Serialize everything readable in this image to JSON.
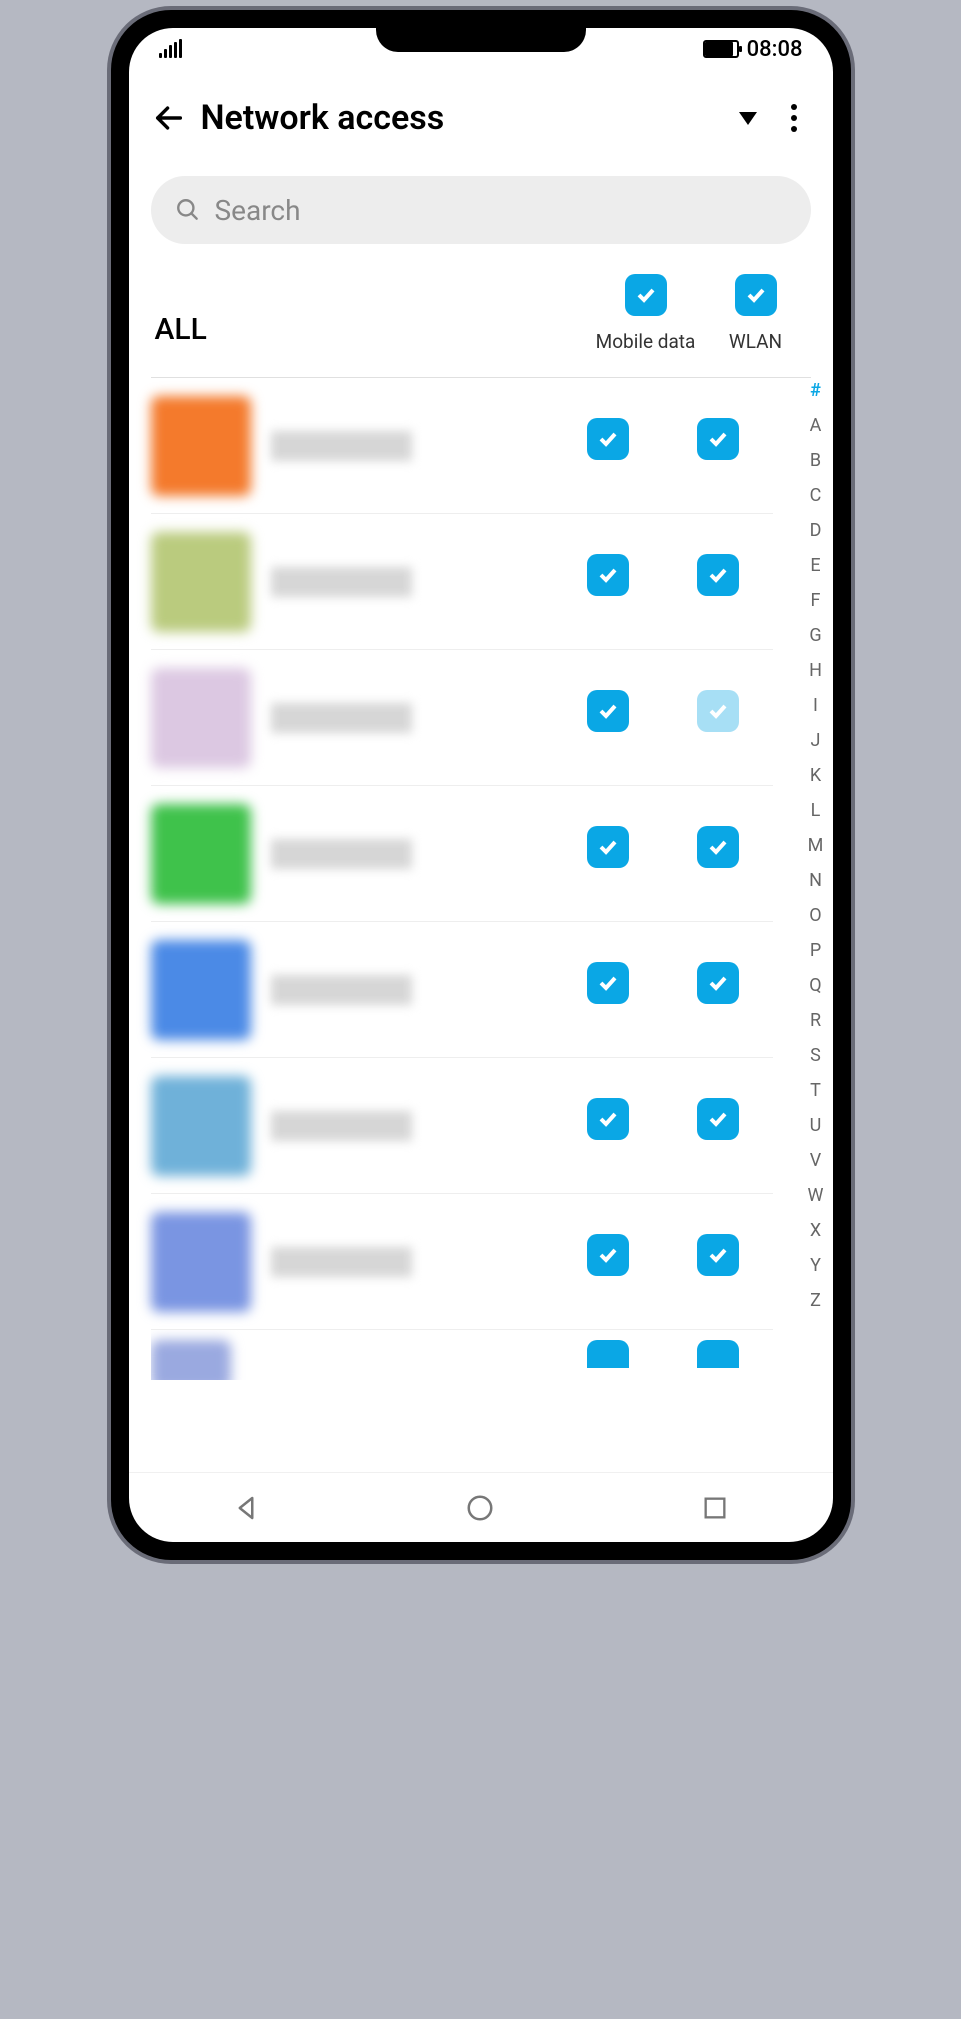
{
  "status": {
    "time": "08:08"
  },
  "header": {
    "title": "Network access"
  },
  "search": {
    "placeholder": "Search"
  },
  "columns": {
    "all": "ALL",
    "mobile": "Mobile data",
    "wlan": "WLAN"
  },
  "apps": [
    {
      "color": "#f47a2c",
      "mobile": true,
      "wlan": true,
      "wlan_dim": false
    },
    {
      "color": "#bacb7e",
      "mobile": true,
      "wlan": true,
      "wlan_dim": false
    },
    {
      "color": "#dcc8e2",
      "mobile": true,
      "wlan": true,
      "wlan_dim": true
    },
    {
      "color": "#3fc24b",
      "mobile": true,
      "wlan": true,
      "wlan_dim": false
    },
    {
      "color": "#4b8ae6",
      "mobile": true,
      "wlan": true,
      "wlan_dim": false
    },
    {
      "color": "#6fb1d9",
      "mobile": true,
      "wlan": true,
      "wlan_dim": false
    },
    {
      "color": "#7a95e2",
      "mobile": true,
      "wlan": true,
      "wlan_dim": false
    }
  ],
  "index": [
    "#",
    "A",
    "B",
    "C",
    "D",
    "E",
    "F",
    "G",
    "H",
    "I",
    "J",
    "K",
    "L",
    "M",
    "N",
    "O",
    "P",
    "Q",
    "R",
    "S",
    "T",
    "U",
    "V",
    "W",
    "X",
    "Y",
    "Z"
  ],
  "index_active": "#"
}
